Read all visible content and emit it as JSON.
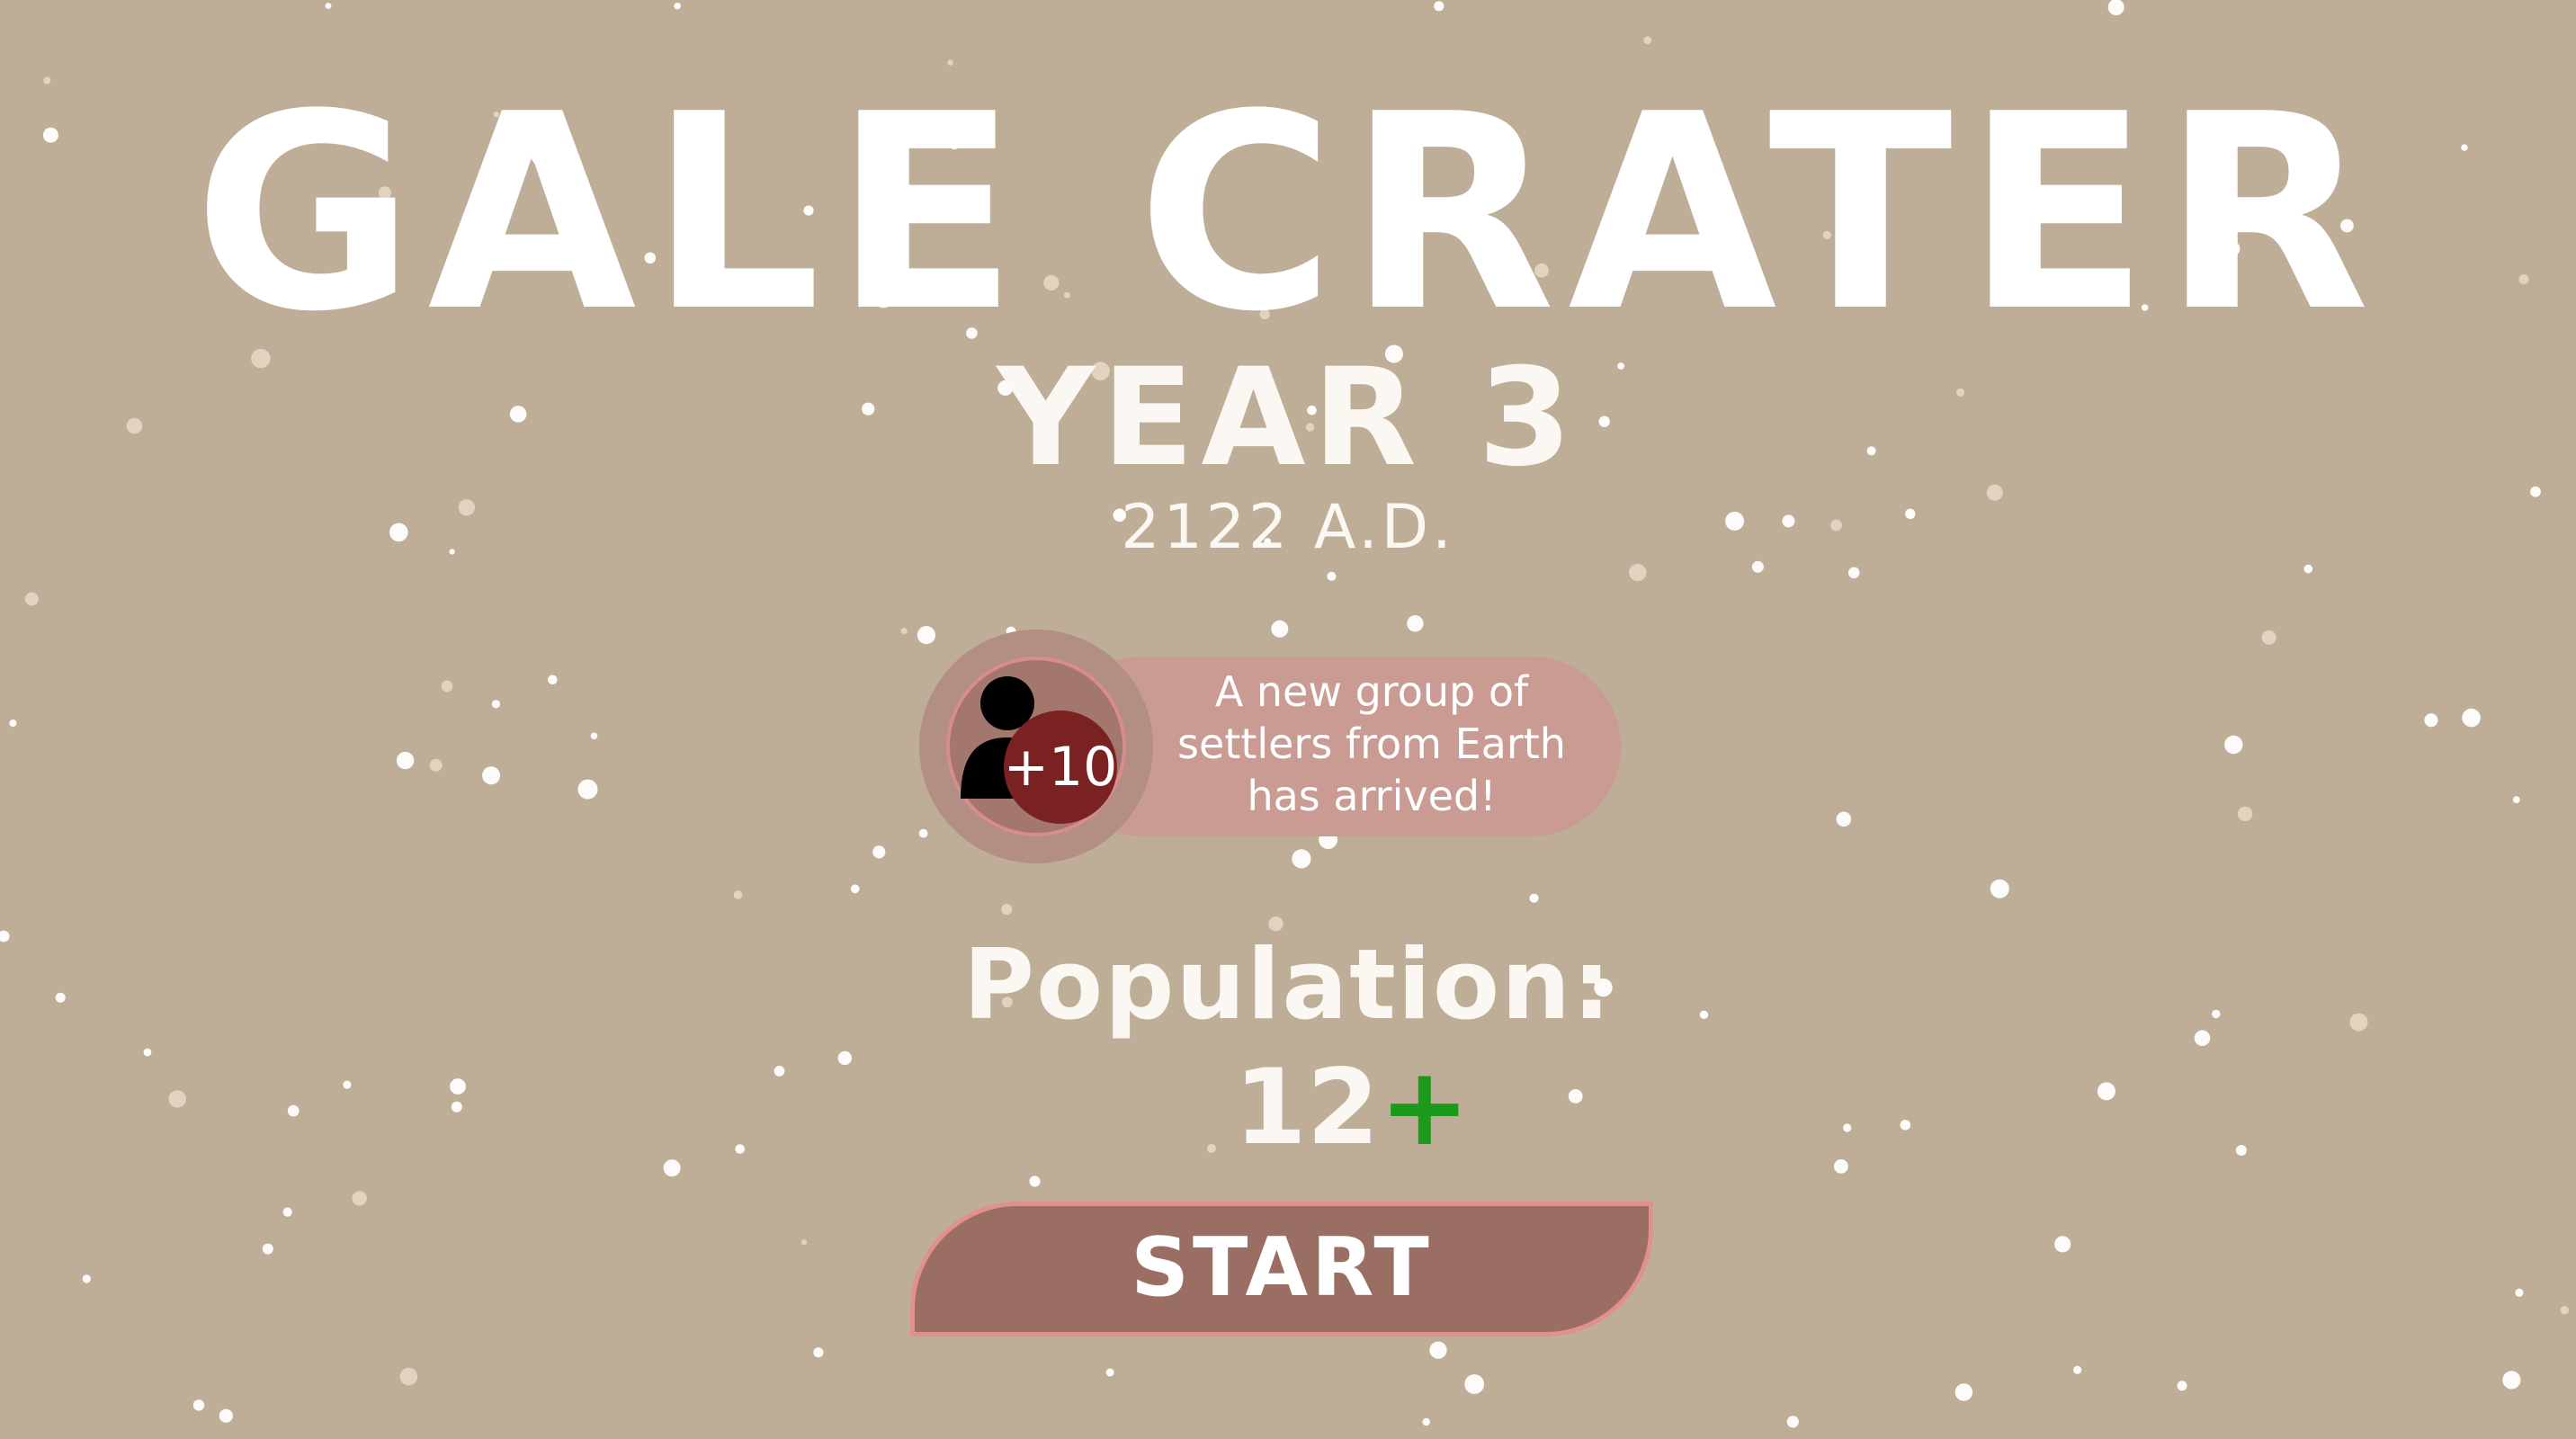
{
  "game": {
    "title": "GALE CRATER",
    "year": "YEAR 3",
    "date": "2122 A.D."
  },
  "notification": {
    "badge": "+10",
    "message": "A new group of settlers from Earth has arrived!",
    "icon": "person-icon"
  },
  "population": {
    "label": "Population:",
    "value": "12",
    "increase_symbol": "+"
  },
  "start_button": {
    "label": "START"
  },
  "colors": {
    "background": "#bfae97",
    "notification_pill": "#c99b93",
    "badge": "#7a2222",
    "button": "#9a6e62",
    "button_border": "#e09090",
    "increase": "#1c9a1c"
  }
}
